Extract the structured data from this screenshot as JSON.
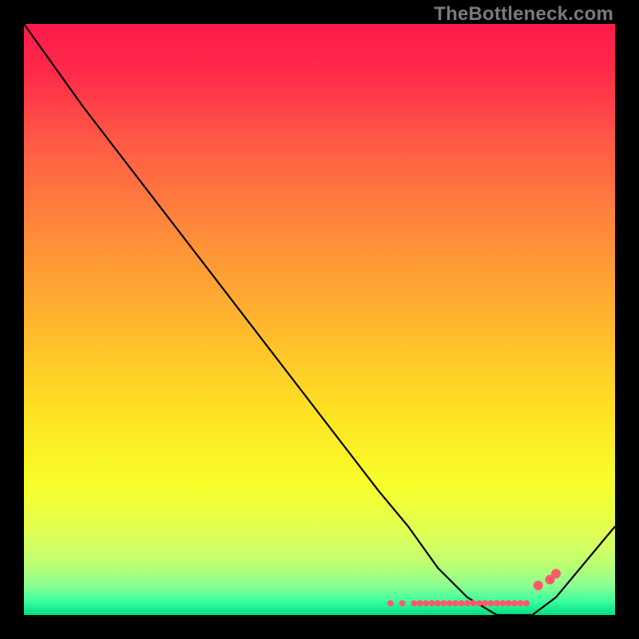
{
  "watermark": "TheBottleneck.com",
  "chart_data": {
    "type": "line",
    "title": "",
    "xlabel": "",
    "ylabel": "",
    "xlim": [
      0,
      100
    ],
    "ylim": [
      0,
      100
    ],
    "grid": false,
    "legend": false,
    "gradient_stops": [
      {
        "offset": 0.0,
        "color": "#ff1a4b"
      },
      {
        "offset": 0.08,
        "color": "#ff2a4a"
      },
      {
        "offset": 0.2,
        "color": "#ff5a45"
      },
      {
        "offset": 0.35,
        "color": "#ff8a3a"
      },
      {
        "offset": 0.5,
        "color": "#ffb52e"
      },
      {
        "offset": 0.65,
        "color": "#ffe022"
      },
      {
        "offset": 0.78,
        "color": "#f7ff2a"
      },
      {
        "offset": 0.86,
        "color": "#e0ff55"
      },
      {
        "offset": 0.91,
        "color": "#c0ff70"
      },
      {
        "offset": 0.95,
        "color": "#8cff90"
      },
      {
        "offset": 0.975,
        "color": "#40ffa0"
      },
      {
        "offset": 1.0,
        "color": "#00e080"
      }
    ],
    "series": [
      {
        "name": "bottleneck-curve",
        "color": "#000000",
        "x": [
          0,
          5,
          10,
          20,
          30,
          40,
          50,
          60,
          65,
          70,
          75,
          80,
          83,
          86,
          90,
          95,
          100
        ],
        "values": [
          100,
          93,
          86,
          73,
          60,
          47,
          34,
          21,
          15,
          8,
          3,
          0,
          0,
          0,
          3,
          9,
          15
        ]
      }
    ],
    "markers": {
      "name": "valley-dots",
      "color": "#ff5a6a",
      "radius_small": 4,
      "radius_large": 6,
      "x": [
        62,
        64,
        66,
        67,
        68,
        69,
        70,
        71,
        72,
        73,
        74,
        75,
        76,
        77,
        78,
        79,
        80,
        81,
        82,
        83,
        84,
        85,
        87,
        89,
        90
      ],
      "values": [
        2,
        2,
        2,
        2,
        2,
        2,
        2,
        2,
        2,
        2,
        2,
        2,
        2,
        2,
        2,
        2,
        2,
        2,
        2,
        2,
        2,
        2,
        5,
        6,
        7
      ],
      "large_indices": [
        22,
        23,
        24
      ]
    }
  }
}
